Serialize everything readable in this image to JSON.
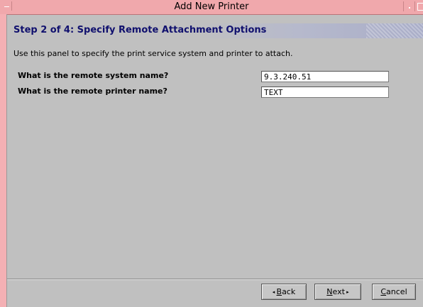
{
  "window": {
    "title": "Add New Printer"
  },
  "step": {
    "title": "Step 2 of 4: Specify Remote Attachment Options"
  },
  "description": "Use this panel to specify the print service system and printer to attach.",
  "fields": [
    {
      "label": "What is the remote system name?",
      "value": "9.3.240.51"
    },
    {
      "label": "What is the remote printer name?",
      "value": "TEXT"
    }
  ],
  "buttons": {
    "back": {
      "prefix": "◂ ",
      "mnemonic": "B",
      "rest": "ack"
    },
    "next": {
      "mnemonic": "N",
      "rest": "ext",
      "suffix": " ▸"
    },
    "cancel": {
      "mnemonic": "C",
      "rest": "ancel"
    }
  },
  "colors": {
    "titlebar": "#f0a8ac",
    "step_title": "#10106e",
    "panel_bg": "#c0c0c0"
  },
  "icons": {
    "window_menu": "window-menu-icon",
    "minimize": "minimize-icon",
    "maximize": "maximize-icon"
  }
}
